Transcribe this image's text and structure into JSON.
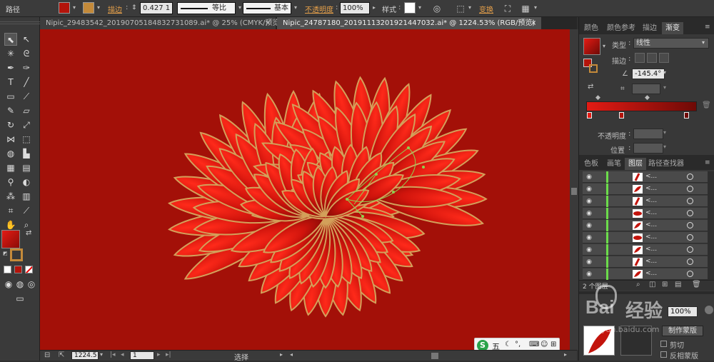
{
  "toolbar": {
    "label": "路径",
    "stroke_label": "描边",
    "stroke_value": "0.427 1",
    "profile_label": "等比",
    "brush_label": "基本",
    "opacity_label": "不透明度",
    "opacity_value": "100%",
    "style_label": "样式",
    "transform_label": "变换",
    "fill_color": "#b3140b",
    "stroke_color": "#c48a3a"
  },
  "tabs": [
    {
      "label": "Nipic_29483542_20190705184832731089.ai* @ 25% (CMYK/预览)",
      "close": "×"
    },
    {
      "label": "Nipic_24787180_20191113201921447032.ai* @ 1224.53% (RGB/预览)",
      "close": "×"
    }
  ],
  "panels": {
    "top_tabs": [
      "颜色",
      "颜色参考",
      "描边",
      "渐变"
    ],
    "gradient": {
      "type_label": "类型",
      "type_value": "线性",
      "stroke_label": "描边",
      "angle_value": "-145.4°",
      "opacity_label": "不透明度",
      "position_label": "位置",
      "start_color": "#e41b14",
      "end_color": "#6e0a06"
    },
    "layers_tabs": [
      "色板",
      "画笔",
      "图层",
      "路径查找器"
    ],
    "layers": [
      {
        "name": "<...",
        "thumb": "red-stroke"
      },
      {
        "name": "<...",
        "thumb": "red-leaf"
      },
      {
        "name": "<...",
        "thumb": "red-stroke"
      },
      {
        "name": "<...",
        "thumb": "red-blob"
      },
      {
        "name": "<...",
        "thumb": "red-leaf"
      },
      {
        "name": "<...",
        "thumb": "red-blob"
      },
      {
        "name": "<...",
        "thumb": "red-leaf"
      },
      {
        "name": "<...",
        "thumb": "red-stroke"
      },
      {
        "name": "<...",
        "thumb": "red-leaf"
      }
    ],
    "layers_count": "2 个图层",
    "transparency": {
      "opacity_value": "100%",
      "make_mask": "制作蒙版",
      "clip": "剪切",
      "invert": "反相蒙版"
    }
  },
  "status": {
    "zoom": "1224.5",
    "page": "1",
    "mode": "选择"
  },
  "ime": {
    "logo": "S",
    "label": "五"
  },
  "watermark": {
    "brand": "Bai",
    "suffix": "经验",
    "url": "jingyan.baidu.com"
  }
}
